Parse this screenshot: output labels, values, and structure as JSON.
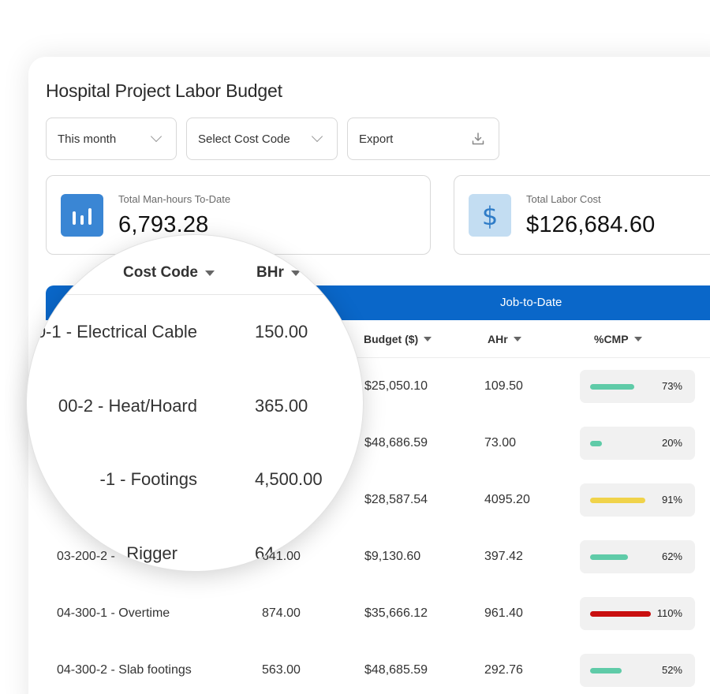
{
  "page": {
    "title": "Hospital Project Labor Budget"
  },
  "controls": {
    "period_label": "This month",
    "cost_code_label": "Select Cost Code",
    "export_label": "Export"
  },
  "kpis": {
    "manhours": {
      "label": "Total Man-hours To-Date",
      "value": "6,793.28",
      "icon": "bar-chart-icon",
      "icon_color": "#3a86d4"
    },
    "cost": {
      "label": "Total Labor Cost",
      "value": "$126,684.60",
      "icon": "dollar-icon",
      "icon_color": "#c3ddf2"
    }
  },
  "table": {
    "band_label": "Job-to-Date",
    "headers": {
      "budget": "Budget ($)",
      "ahr": "AHr",
      "cmp": "%CMP"
    },
    "rows": [
      {
        "cost_code": "",
        "bhr": "",
        "budget": "$25,050.10",
        "ahr": "109.50",
        "cmp": "73%",
        "fill": 0.73,
        "color": "#5fcba8"
      },
      {
        "cost_code": "",
        "bhr": "",
        "budget": "$48,686.59",
        "ahr": "73.00",
        "cmp": "20%",
        "fill": 0.2,
        "color": "#5fcba8"
      },
      {
        "cost_code": "",
        "bhr": "",
        "budget": "$28,587.54",
        "ahr": "4095.20",
        "cmp": "91%",
        "fill": 0.91,
        "color": "#f0d34a"
      },
      {
        "cost_code": "03-200-2 -",
        "bhr": "641.00",
        "budget": "$9,130.60",
        "ahr": "397.42",
        "cmp": "62%",
        "fill": 0.62,
        "color": "#5fcba8"
      },
      {
        "cost_code": "04-300-1 - Overtime",
        "bhr": "874.00",
        "budget": "$35,666.12",
        "ahr": "961.40",
        "cmp": "110%",
        "fill": 1.0,
        "color": "#c90f0f"
      },
      {
        "cost_code": "04-300-2 - Slab footings",
        "bhr": "563.00",
        "budget": "$48,685.59",
        "ahr": "292.76",
        "cmp": "52%",
        "fill": 0.52,
        "color": "#5fcba8"
      }
    ]
  },
  "magnifier": {
    "headers": {
      "cost_code": "Cost Code",
      "bhr": "BHr"
    },
    "rows": [
      {
        "cost_code": "0-1  - Electrical Cable",
        "bhr": "150.00"
      },
      {
        "cost_code": "00-2 -  Heat/Hoard",
        "bhr": "365.00"
      },
      {
        "cost_code": "-1 -  Footings",
        "bhr": "4,500.00"
      },
      {
        "cost_code": "Rigger",
        "bhr": "64"
      }
    ]
  }
}
